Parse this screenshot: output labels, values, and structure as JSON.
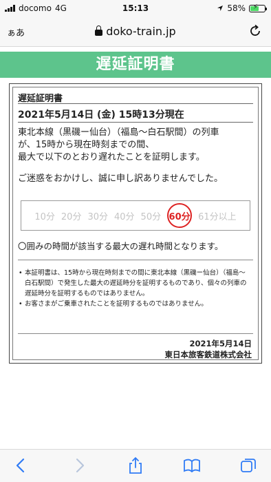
{
  "status_bar": {
    "carrier": "docomo",
    "network": "4G",
    "time": "15:13",
    "battery_percent_label": "58%",
    "battery_level": 0.58
  },
  "address_bar": {
    "aa_label": "ぁあ",
    "url": "doko-train.jp"
  },
  "header": {
    "title": "遅延証明書"
  },
  "certificate": {
    "title": "遅延証明書",
    "date_line": "2021年5月14日 (金) 15時13分現在",
    "body_lines": [
      "東北本線（黒磯ー仙台）（福島〜白石駅間）の列車",
      "が、15時から現在時刻までの間、",
      "最大で以下のとおり遅れたことを証明します。"
    ],
    "apology": "ご迷惑をおかけし、誠に申し訳ありませんでした。",
    "delay_options": [
      "10分",
      "20分",
      "30分",
      "40分",
      "50分",
      "60分",
      "61分以上"
    ],
    "selected_delay": "60分",
    "note_main": "〇囲みの時間が該当する最大の遅れ時間となります。",
    "notes": [
      "本証明書は、15時から現在時刻までの間に東北本線（黒磯ー仙台）（福島〜白石駅間）で発生した最大の遅延時分を証明するものであり、個々の列車の遅延時分を証明するものではありません。",
      "お客さまがご乗車されたことを証明するものではありません。"
    ],
    "issue_date": "2021年5月14日",
    "company": "東日本旅客鉄道株式会社"
  },
  "colors": {
    "header_green": "#5dc48c",
    "selected_red": "#dd2222",
    "toolbar_blue": "#2f7bf5"
  }
}
